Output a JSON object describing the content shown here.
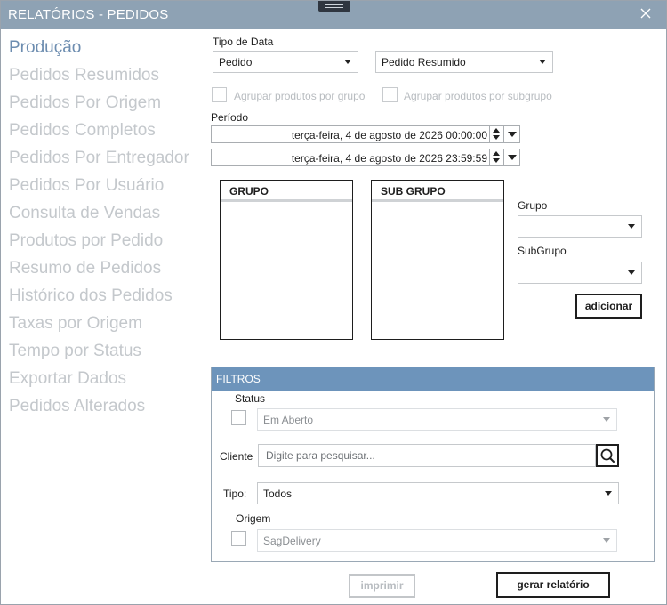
{
  "window": {
    "title": "RELATÓRIOS - PEDIDOS"
  },
  "nav": {
    "items": [
      {
        "label": "Produção",
        "active": true
      },
      {
        "label": "Pedidos Resumidos"
      },
      {
        "label": "Pedidos Por Origem"
      },
      {
        "label": "Pedidos Completos"
      },
      {
        "label": "Pedidos Por Entregador"
      },
      {
        "label": "Pedidos Por Usuário"
      },
      {
        "label": "Consulta de Vendas"
      },
      {
        "label": "Produtos por Pedido"
      },
      {
        "label": "Resumo de Pedidos"
      },
      {
        "label": "Histórico dos Pedidos"
      },
      {
        "label": "Taxas por Origem"
      },
      {
        "label": "Tempo por Status"
      },
      {
        "label": "Exportar Dados"
      },
      {
        "label": "Pedidos Alterados"
      }
    ]
  },
  "form": {
    "tipo_data_label": "Tipo de Data",
    "tipo_data_value": "Pedido",
    "modo_value": "Pedido Resumido",
    "agrupar_grupo_label": "Agrupar produtos por grupo",
    "agrupar_subgrupo_label": "Agrupar produtos por subgrupo",
    "periodo_label": "Período",
    "data_inicio": "terça-feira, 4 de agosto de 2026 00:00:00",
    "data_fim": "terça-feira, 4 de agosto de 2026 23:59:59",
    "grupo_list_header": "GRUPO",
    "subgrupo_list_header": "SUB GRUPO",
    "grupo_label": "Grupo",
    "grupo_value": "",
    "subgrupo_label": "SubGrupo",
    "subgrupo_value": "",
    "adicionar_label": "adicionar"
  },
  "filtros": {
    "title": "FILTROS",
    "status_label": "Status",
    "status_value": "Em Aberto",
    "cliente_label": "Cliente",
    "cliente_placeholder": "Digite para pesquisar...",
    "tipo_label": "Tipo:",
    "tipo_value": "Todos",
    "origem_label": "Origem",
    "origem_value": "SagDelivery"
  },
  "actions": {
    "imprimir_label": "imprimir",
    "gerar_label": "gerar relatório"
  },
  "icons": {
    "close": "close-icon",
    "search": "search-icon",
    "grip": "drag-handle-icon"
  },
  "colors": {
    "titlebar": "#8ea2b4",
    "accent": "#6d8db0",
    "filtros_bar": "#6d94bb"
  }
}
